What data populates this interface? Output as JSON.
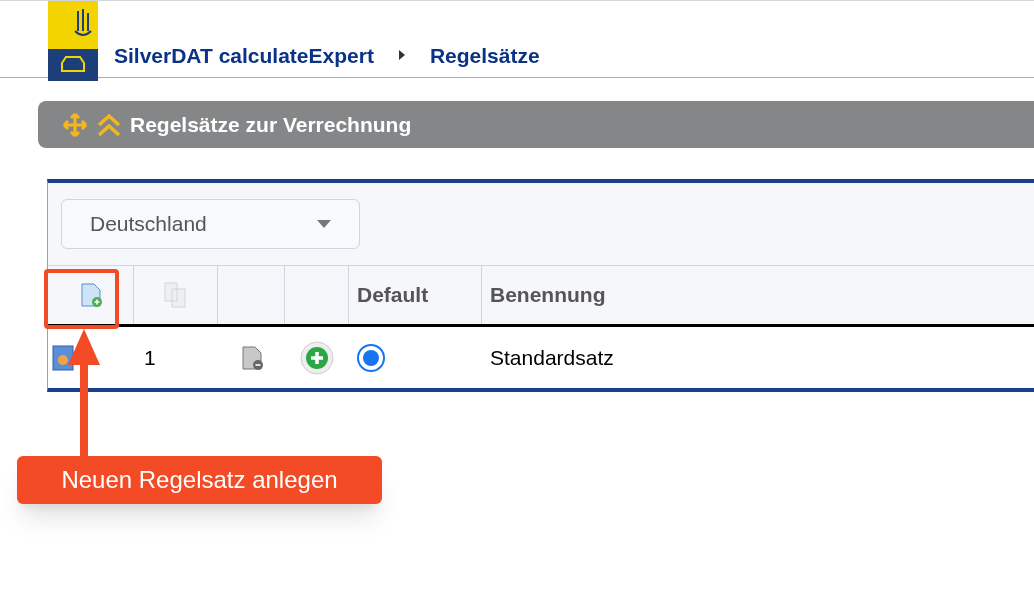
{
  "breadcrumb": [
    {
      "label": "SilverDAT calculateExpert"
    },
    {
      "label": "Regelsätze"
    }
  ],
  "panel": {
    "title": "Regelsätze zur Verrechnung"
  },
  "country_select": {
    "value": "Deutschland"
  },
  "table": {
    "columns": [
      "Default",
      "Benennung"
    ],
    "rows": [
      {
        "number": "1",
        "default": true,
        "name": "Standardsatz"
      }
    ]
  },
  "annotation": {
    "label": "Neuen Regelsatz anlegen"
  }
}
